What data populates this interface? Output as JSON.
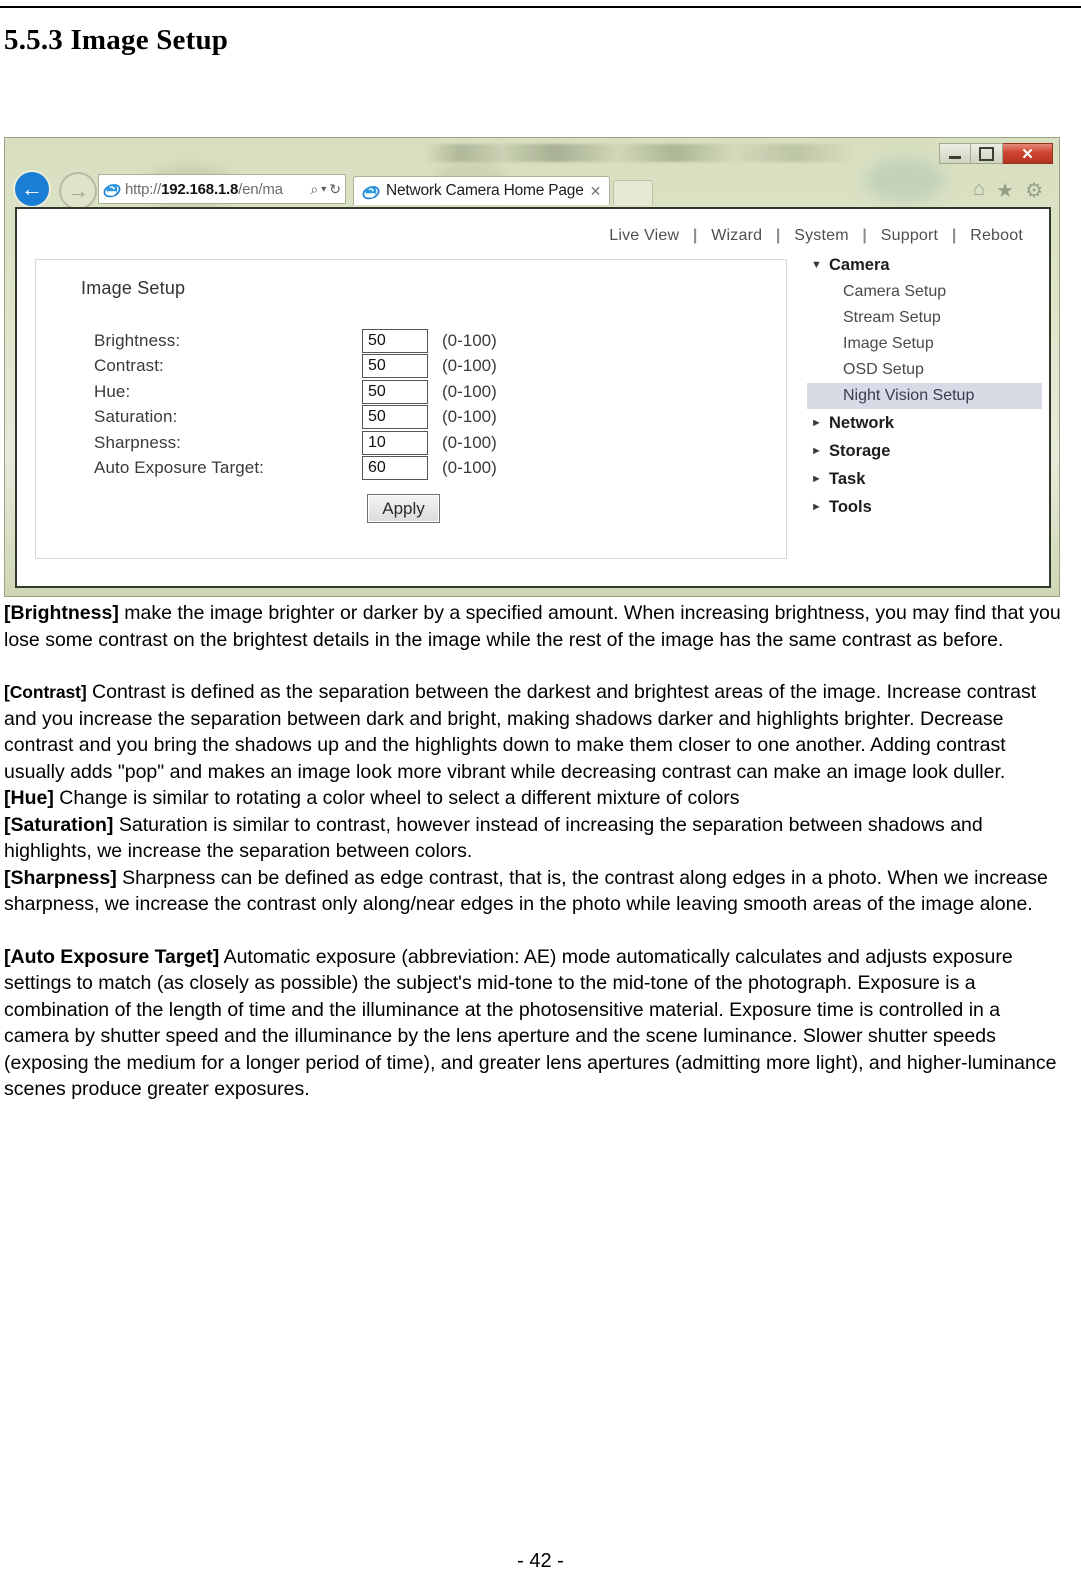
{
  "document": {
    "heading": "5.5.3 Image Setup",
    "footer_page": "- 42 -"
  },
  "browser": {
    "window_controls": {
      "minimize": "minimize-button",
      "restore": "restore-button",
      "close": "✕"
    },
    "nav": {
      "back": "←",
      "forward": "→"
    },
    "address": {
      "scheme": "http://",
      "host": "192.168.1.8",
      "path": "/en/ma",
      "full_url": "http://192.168.1.8/en/ma",
      "search_icon": "⌕",
      "dropdown_icon": "▾",
      "refresh_icon": "↻"
    },
    "tab": {
      "title": "Network Camera Home Page",
      "close": "✕"
    },
    "toolbar_icons": {
      "home": "⌂",
      "favorites": "★",
      "tools": "⚙"
    }
  },
  "webpage": {
    "top_nav": [
      "Live View",
      "Wizard",
      "System",
      "Support",
      "Reboot"
    ],
    "nav_separator": "|",
    "panel": {
      "title": "Image Setup",
      "rows": [
        {
          "label": "Brightness:",
          "value": "50",
          "range": "(0-100)"
        },
        {
          "label": "Contrast:",
          "value": "50",
          "range": "(0-100)"
        },
        {
          "label": "Hue:",
          "value": "50",
          "range": "(0-100)"
        },
        {
          "label": "Saturation:",
          "value": "50",
          "range": "(0-100)"
        },
        {
          "label": "Sharpness:",
          "value": "10",
          "range": "(0-100)"
        },
        {
          "label": "Auto Exposure Target:",
          "value": "60",
          "range": "(0-100)"
        }
      ],
      "apply_label": "Apply"
    },
    "side_menu": {
      "expanded_caret": "▼",
      "collapsed_caret": "►",
      "groups": [
        {
          "label": "Camera",
          "expanded": true,
          "children": [
            {
              "label": "Camera Setup",
              "active": false
            },
            {
              "label": "Stream Setup",
              "active": false
            },
            {
              "label": "Image Setup",
              "active": false
            },
            {
              "label": "OSD Setup",
              "active": false
            },
            {
              "label": "Night Vision Setup",
              "active": true
            }
          ]
        },
        {
          "label": "Network",
          "expanded": false,
          "children": []
        },
        {
          "label": "Storage",
          "expanded": false,
          "children": []
        },
        {
          "label": "Task",
          "expanded": false,
          "children": []
        },
        {
          "label": "Tools",
          "expanded": false,
          "children": []
        }
      ]
    },
    "highlight_color": "#d8dae6"
  },
  "descriptions": {
    "brightness": {
      "tag": "[Brightness]",
      "text": " make the image brighter or darker by a specified amount. When increasing brightness, you may find that you lose some contrast on the brightest details in the image while the rest of the image has the same contrast as before."
    },
    "contrast": {
      "tag": "[Contrast]",
      "text": " Contrast is defined as the separation between the darkest and brightest areas of the image. Increase contrast and you increase the separation between dark and bright, making shadows darker and highlights brighter. Decrease contrast and you bring the shadows up and the highlights down to make them closer to one another. Adding contrast usually adds \"pop\" and makes an image look more vibrant while decreasing contrast can make an image look duller."
    },
    "hue": {
      "tag": "[Hue]",
      "text": " Change is similar to rotating a color wheel to select a different mixture of colors"
    },
    "saturation": {
      "tag": "[Saturation]",
      "text": " Saturation is similar to contrast, however instead of increasing the separation between shadows and highlights, we increase the separation between colors."
    },
    "sharpness": {
      "tag": "[Sharpness]",
      "text": " Sharpness can be defined as edge contrast, that is, the contrast along edges in a photo. When we increase sharpness, we increase the contrast only along/near edges in the photo while leaving smooth areas of the image alone."
    },
    "auto_exposure_target": {
      "tag": "[Auto Exposure Target]",
      "text": " Automatic exposure (abbreviation: AE) mode automatically calculates and adjusts exposure settings to match (as closely as possible) the subject's mid-tone to the mid-tone of the photograph. Exposure is a combination of the length of time and the illuminance at the photosensitive material. Exposure time is controlled in a camera by shutter speed and the illuminance by the lens aperture and the scene luminance. Slower shutter speeds (exposing the medium for a longer period of time), and greater lens apertures (admitting more light), and higher-luminance scenes produce greater exposures."
    }
  }
}
